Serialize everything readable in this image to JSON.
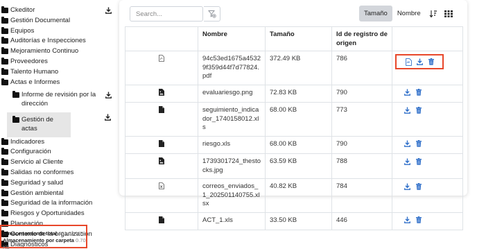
{
  "sidebar": {
    "folders": [
      {
        "label": "Ckeditor",
        "download": true
      },
      {
        "label": "Gestión Documental"
      },
      {
        "label": "Equipos"
      },
      {
        "label": "Auditorías e Inspecciones"
      },
      {
        "label": "Mejoramiento Continuo"
      },
      {
        "label": "Proveedores"
      },
      {
        "label": "Talento Humano"
      },
      {
        "label": "Actas e Informes"
      }
    ],
    "subfolders": [
      {
        "label": "Informe de revisión por la dirección",
        "download": true
      },
      {
        "label": "Gestión de actas",
        "download": true,
        "selected": true
      }
    ],
    "folders_after": [
      {
        "label": "Indicadores"
      },
      {
        "label": "Configuración"
      },
      {
        "label": "Servicio al Cliente"
      },
      {
        "label": "Salidas no conformes"
      },
      {
        "label": "Seguridad y salud"
      },
      {
        "label": "Gestión ambiental"
      },
      {
        "label": "Seguridad de la información"
      },
      {
        "label": "Riesgos y Oportunidades"
      },
      {
        "label": "Planeación"
      },
      {
        "label": "Contexto de la organización"
      },
      {
        "label": "Diagnósticos"
      }
    ],
    "storage": {
      "total_label": "Almacenamiento total",
      "total_value": "431.63 MB",
      "folder_label": "Almacenamiento por carpeta",
      "folder_value": "0.70 KB"
    }
  },
  "toolbar": {
    "search_placeholder": "Search...",
    "sort_size": "Tamaño",
    "sort_name": "Nombre",
    "active_sort": "Tamaño"
  },
  "table": {
    "headers": [
      "Nombre",
      "Tamaño",
      "Id de registro de origen"
    ],
    "rows": [
      {
        "icon": "pdf-file-icon",
        "name": "94c53ed1675a45329f359d44f7d77824.pdf",
        "size": "372.49 KB",
        "origin": "786",
        "preview": true,
        "highlight": true
      },
      {
        "icon": "image-file-icon",
        "name": "evaluariesgo.png",
        "size": "72.83 KB",
        "origin": "790"
      },
      {
        "icon": "file-icon",
        "name": "seguimiento_indicador_1740158012.xls",
        "size": "68.00 KB",
        "origin": "773"
      },
      {
        "icon": "file-icon",
        "name": "riesgo.xls",
        "size": "68.00 KB",
        "origin": "790"
      },
      {
        "icon": "image-file-icon",
        "name": "1739301724_thestocks.jpg",
        "size": "63.59 KB",
        "origin": "788"
      },
      {
        "icon": "excel-file-icon",
        "name": "correos_enviados_1_202501140755.xlsx",
        "size": "40.82 KB",
        "origin": "784"
      },
      {
        "icon": "file-icon",
        "name": "ACT_1.xls",
        "size": "33.50 KB",
        "origin": "446"
      }
    ]
  },
  "colors": {
    "accent": "#2f6fc9",
    "highlight": "#e8472a",
    "active_sort_bg": "#d3d6db"
  }
}
